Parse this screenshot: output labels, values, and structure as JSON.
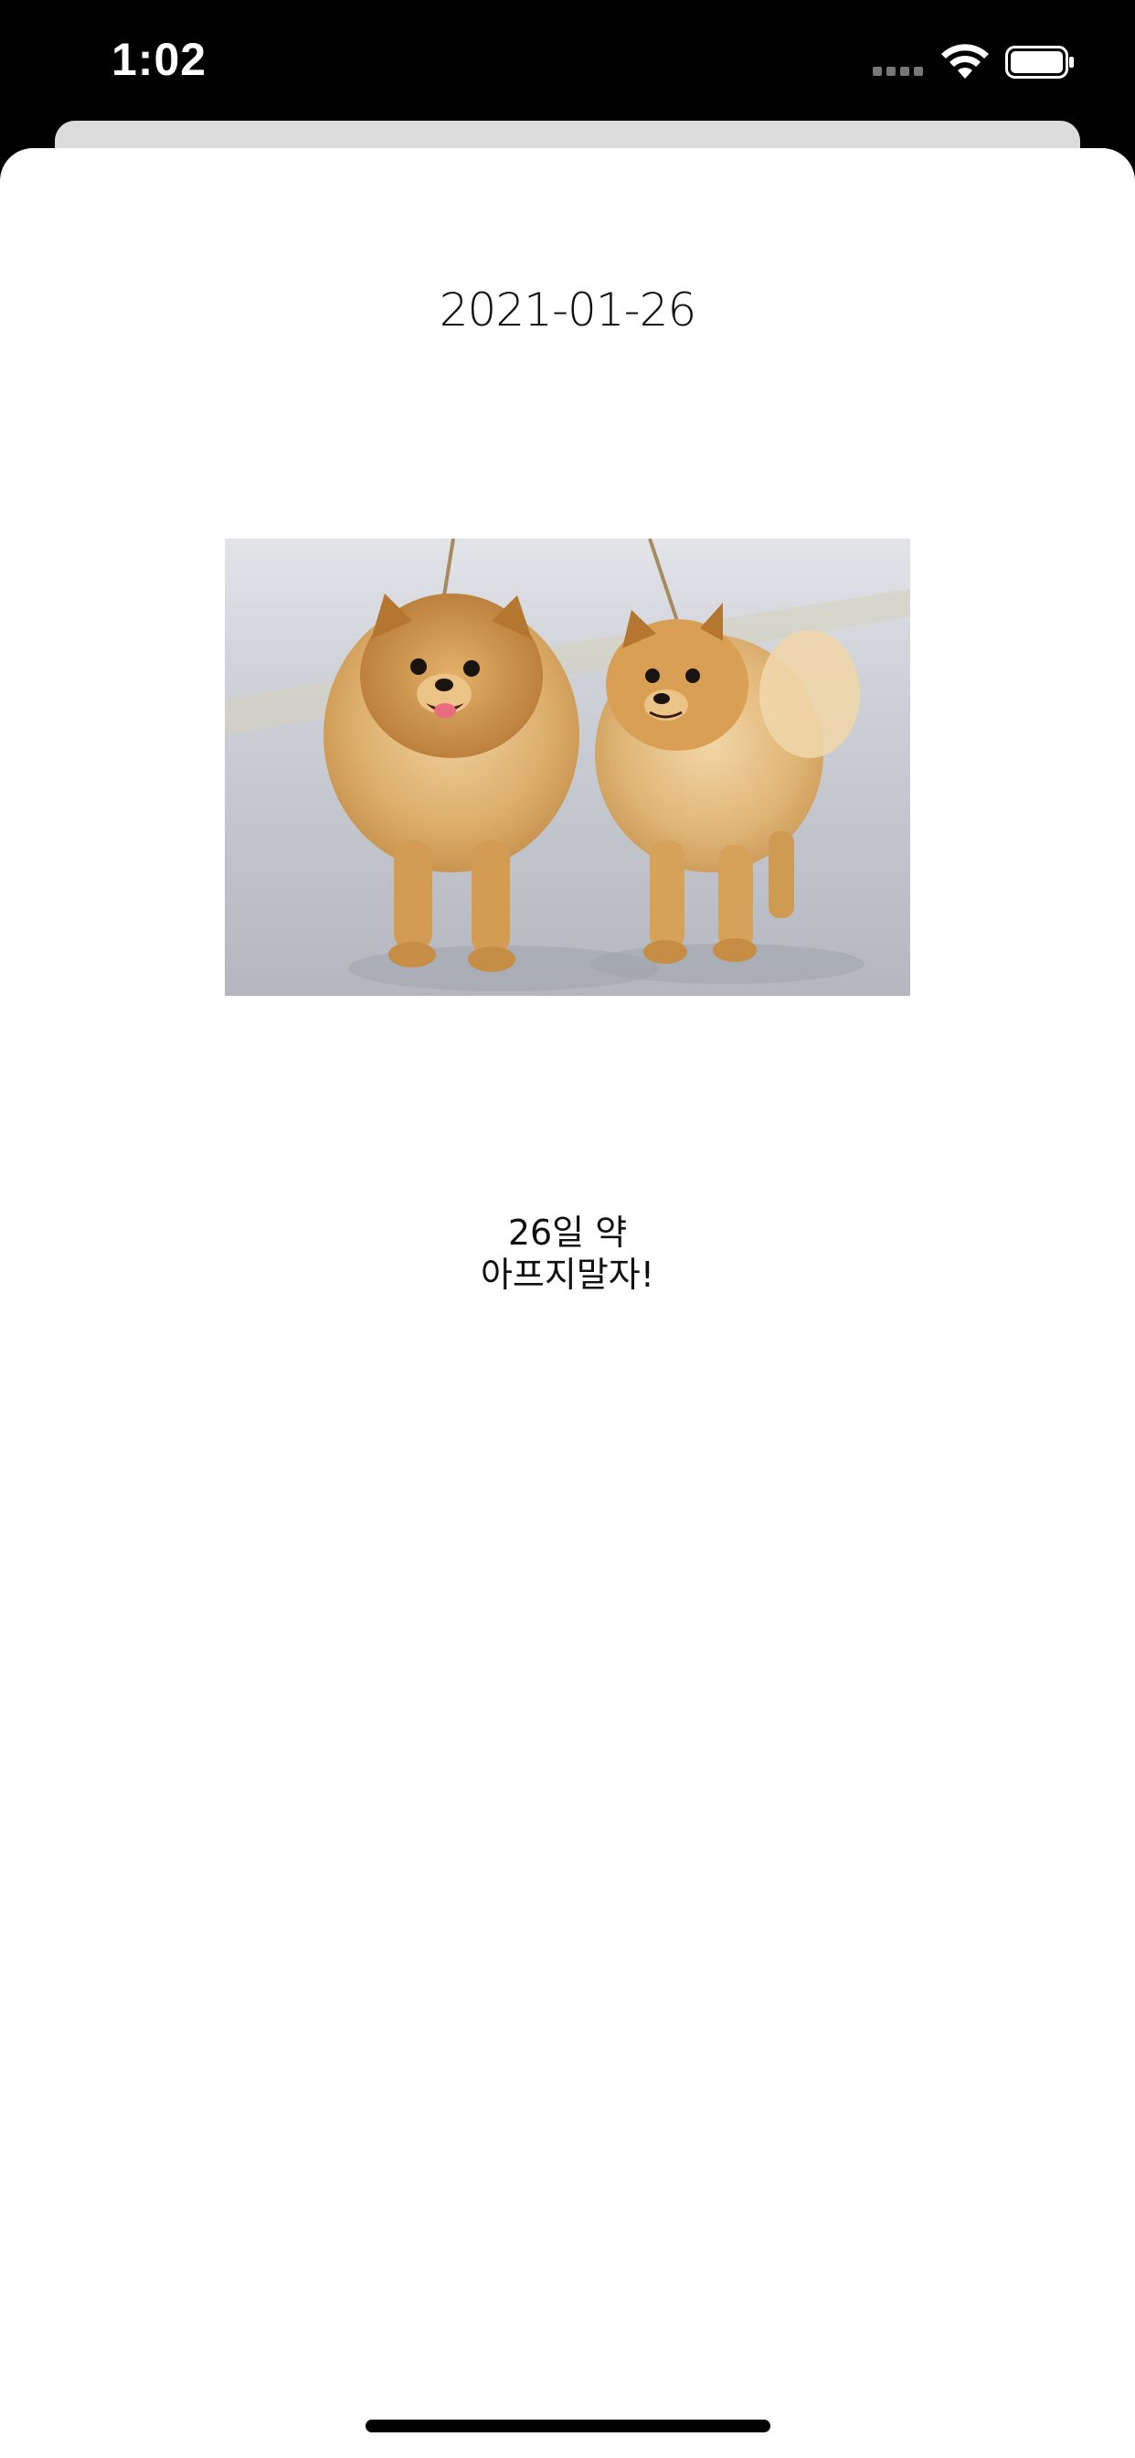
{
  "status_bar": {
    "time": "1:02",
    "icons": [
      "cellular-signal-icon",
      "wifi-icon",
      "battery-icon"
    ]
  },
  "card": {
    "date": "2021-01-26",
    "image": {
      "subject": "two pomeranian dogs on leashes",
      "colors": {
        "fur": "#d9a85e",
        "background": "#c8ccd2",
        "ground": "#b9bcc4"
      }
    },
    "message": {
      "line1": "26일 약",
      "line2": "아프지말자!"
    }
  },
  "colors": {
    "status_background": "#000000",
    "sheet_background": "#ffffff",
    "back_card": "#dcdcdc"
  }
}
